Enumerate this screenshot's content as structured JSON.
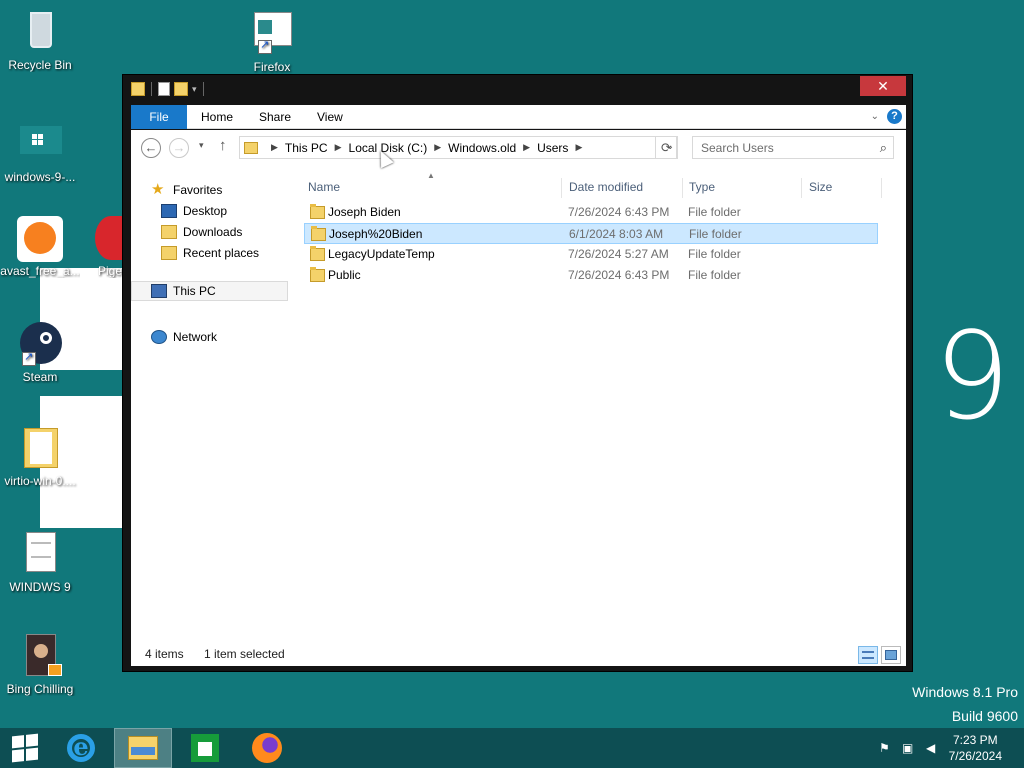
{
  "desktop": {
    "icons": [
      {
        "label": "Recycle Bin"
      },
      {
        "label": "Firefox"
      },
      {
        "label": "windows-9-..."
      },
      {
        "label": "avast_free_a..."
      },
      {
        "label": "Pige"
      },
      {
        "label": "Steam"
      },
      {
        "label": "virtio-win-0...."
      },
      {
        "label": "WINDWS 9"
      },
      {
        "label": "Bing Chilling"
      }
    ],
    "wallpaper_digit": "9",
    "os_name": "Windows 8.1 Pro",
    "os_build": "Build 9600"
  },
  "window": {
    "close_glyph": "✕",
    "ribbon_tabs": [
      "File",
      "Home",
      "Share",
      "View"
    ],
    "help_glyph": "?",
    "breadcrumbs": [
      "This PC",
      "Local Disk (C:)",
      "Windows.old",
      "Users"
    ],
    "search_placeholder": "Search Users",
    "nav_pane": {
      "favorites": "Favorites",
      "desktop": "Desktop",
      "downloads": "Downloads",
      "recent": "Recent places",
      "this_pc": "This PC",
      "network": "Network"
    },
    "columns": {
      "name": "Name",
      "date": "Date modified",
      "type": "Type",
      "size": "Size"
    },
    "files": [
      {
        "name": "Joseph Biden",
        "date": "7/26/2024 6:43 PM",
        "type": "File folder",
        "selected": false
      },
      {
        "name": "Joseph%20Biden",
        "date": "6/1/2024 8:03 AM",
        "type": "File folder",
        "selected": true
      },
      {
        "name": "LegacyUpdateTemp",
        "date": "7/26/2024 5:27 AM",
        "type": "File folder",
        "selected": false
      },
      {
        "name": "Public",
        "date": "7/26/2024 6:43 PM",
        "type": "File folder",
        "selected": false
      }
    ],
    "status": {
      "items": "4 items",
      "selected": "1 item selected"
    }
  },
  "taskbar": {
    "clock_time": "7:23 PM",
    "clock_date": "7/26/2024"
  },
  "colors": {
    "desktop_bg": "#11787b",
    "taskbar_bg": "#0d4e53",
    "ribbon_file_tab": "#1979ca",
    "selection_bg": "#cce8ff",
    "close_button": "#c7383d"
  }
}
